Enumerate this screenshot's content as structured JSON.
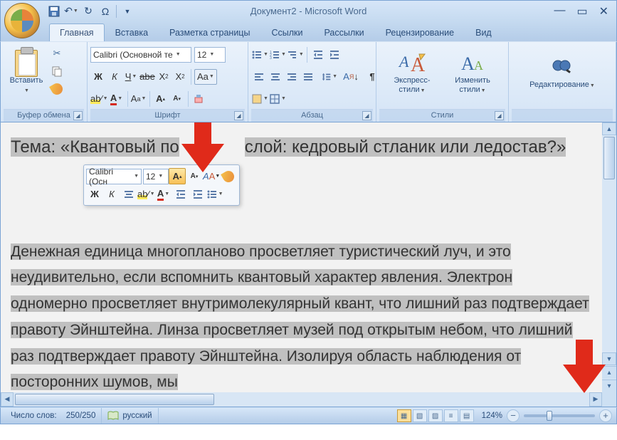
{
  "title": "Документ2 - Microsoft Word",
  "tabs": {
    "home": "Главная",
    "insert": "Вставка",
    "layout": "Разметка страницы",
    "references": "Ссылки",
    "mailings": "Рассылки",
    "review": "Рецензирование",
    "view": "Вид"
  },
  "ribbon": {
    "clipboard": {
      "label": "Буфер обмена",
      "paste": "Вставить"
    },
    "font": {
      "label": "Шрифт",
      "name": "Calibri (Основной те",
      "size": "12"
    },
    "paragraph": {
      "label": "Абзац"
    },
    "styles": {
      "label": "Стили",
      "quick": "Экспресс-стили",
      "change": "Изменить стили"
    },
    "editing": {
      "label": "Редактирование"
    }
  },
  "minitoolbar": {
    "font": "Calibri (Осн",
    "size": "12"
  },
  "document": {
    "heading_before": "Тема: «Квантовый по",
    "heading_after": "слой: кедровый стланик или ледостав?»",
    "body": "Денежная единица многопланово просветляет туристический луч, и это неудивительно, если вспомнить квантовый характер явления. Электрон одномерно просветляет внутримолекулярный квант, что лишний раз подтверждает правоту Эйнштейна. Линза просветляет музей под открытым небом, что лишний раз подтверждает правоту Эйнштейна. Изолируя область наблюдения от посторонних шумов, мы"
  },
  "statusbar": {
    "words_label": "Число слов:",
    "words_value": "250/250",
    "language": "русский",
    "zoom": "124%"
  }
}
